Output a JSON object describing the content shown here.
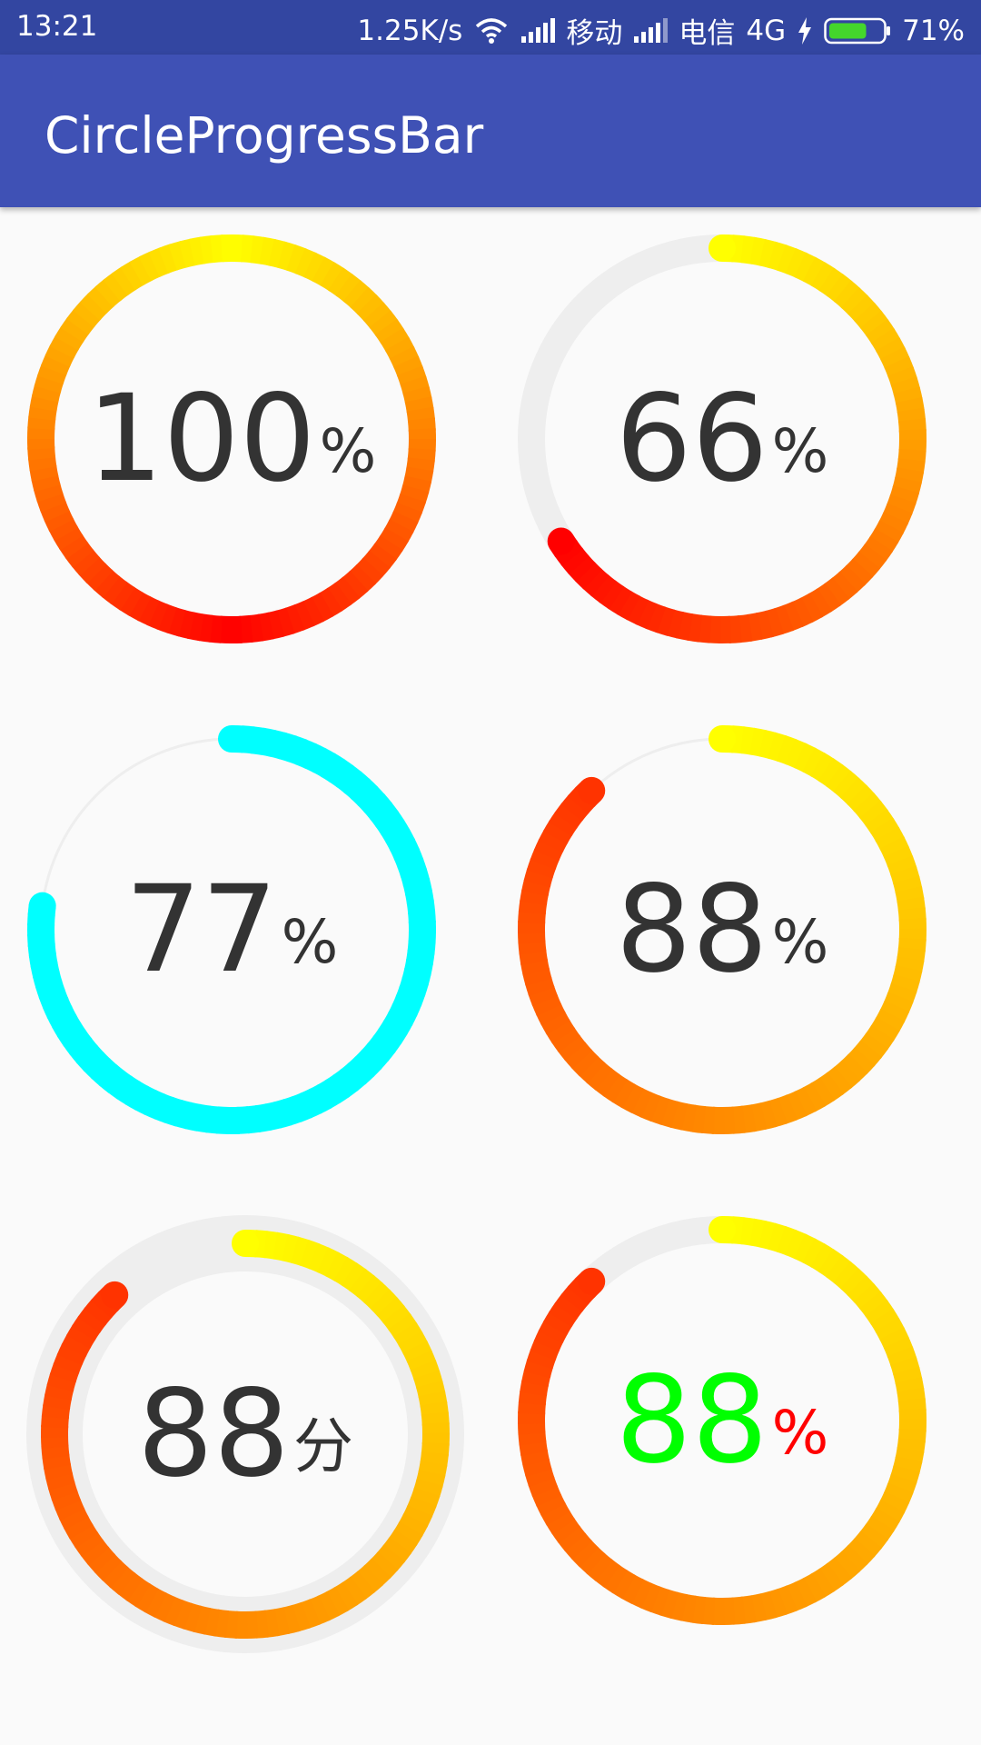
{
  "status_bar": {
    "time": "13:21",
    "net_speed": "1.25K/s",
    "carrier1": "移动",
    "carrier2": "电信",
    "network_type": "4G",
    "battery_percent": "71%",
    "battery_level": 0.71,
    "icons": [
      "wifi-icon",
      "signal-icon",
      "signal-icon",
      "charging-icon",
      "battery-icon"
    ]
  },
  "app_bar": {
    "title": "CircleProgressBar"
  },
  "progress_bars": [
    {
      "value": "100",
      "unit": "%",
      "progress": 1.0,
      "colors": [
        "#ffff00",
        "#ff0000"
      ],
      "value_color": "#333333",
      "unit_color": "#333333"
    },
    {
      "value": "66",
      "unit": "%",
      "progress": 0.66,
      "colors": [
        "#ffff00",
        "#ff0000"
      ],
      "value_color": "#333333",
      "unit_color": "#333333"
    },
    {
      "value": "77",
      "unit": "%",
      "progress": 0.77,
      "colors": [
        "#00ffff",
        "#00ffff"
      ],
      "value_color": "#333333",
      "unit_color": "#333333"
    },
    {
      "value": "88",
      "unit": "%",
      "progress": 0.88,
      "colors": [
        "#ffff00",
        "#ff3300"
      ],
      "value_color": "#333333",
      "unit_color": "#333333"
    },
    {
      "value": "88",
      "unit": "分",
      "progress": 0.88,
      "colors": [
        "#ffff00",
        "#ff3300"
      ],
      "value_color": "#333333",
      "unit_color": "#333333"
    },
    {
      "value": "88",
      "unit": "%",
      "progress": 0.88,
      "colors": [
        "#ffff00",
        "#ff3300"
      ],
      "value_color": "#00ff00",
      "unit_color": "#ff0000"
    }
  ]
}
